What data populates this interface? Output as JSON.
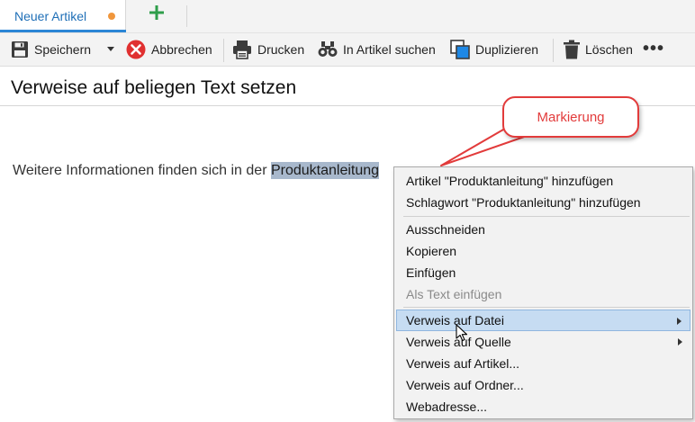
{
  "tabs": {
    "active_label": "Neuer Artikel",
    "unsaved_color": "#f0963c",
    "add_icon": "plus-icon"
  },
  "toolbar": {
    "save": "Speichern",
    "cancel": "Abbrechen",
    "print": "Drucken",
    "search": "In Artikel suchen",
    "duplicate": "Duplizieren",
    "delete": "Löschen",
    "more": "•••"
  },
  "page": {
    "title": "Verweise auf beliegen Text setzen",
    "text_before": "Weitere Informationen finden sich in der ",
    "text_selected": "Produktanleitung"
  },
  "callout": {
    "label": "Markierung",
    "color": "#e23b3b"
  },
  "context_menu": {
    "items": [
      {
        "label": "Artikel \"Produktanleitung\" hinzufügen"
      },
      {
        "label": "Schlagwort \"Produktanleitung\" hinzufügen"
      },
      {
        "label": "Ausschneiden"
      },
      {
        "label": "Kopieren"
      },
      {
        "label": "Einfügen"
      },
      {
        "label": "Als Text einfügen",
        "disabled": true
      },
      {
        "label": "Verweis auf Datei",
        "submenu": true,
        "highlighted": true
      },
      {
        "label": "Verweis auf Quelle",
        "submenu": true
      },
      {
        "label": "Verweis auf Artikel..."
      },
      {
        "label": "Verweis auf Ordner..."
      },
      {
        "label": "Webadresse..."
      }
    ],
    "highlight_color": "#c6dcf2"
  }
}
